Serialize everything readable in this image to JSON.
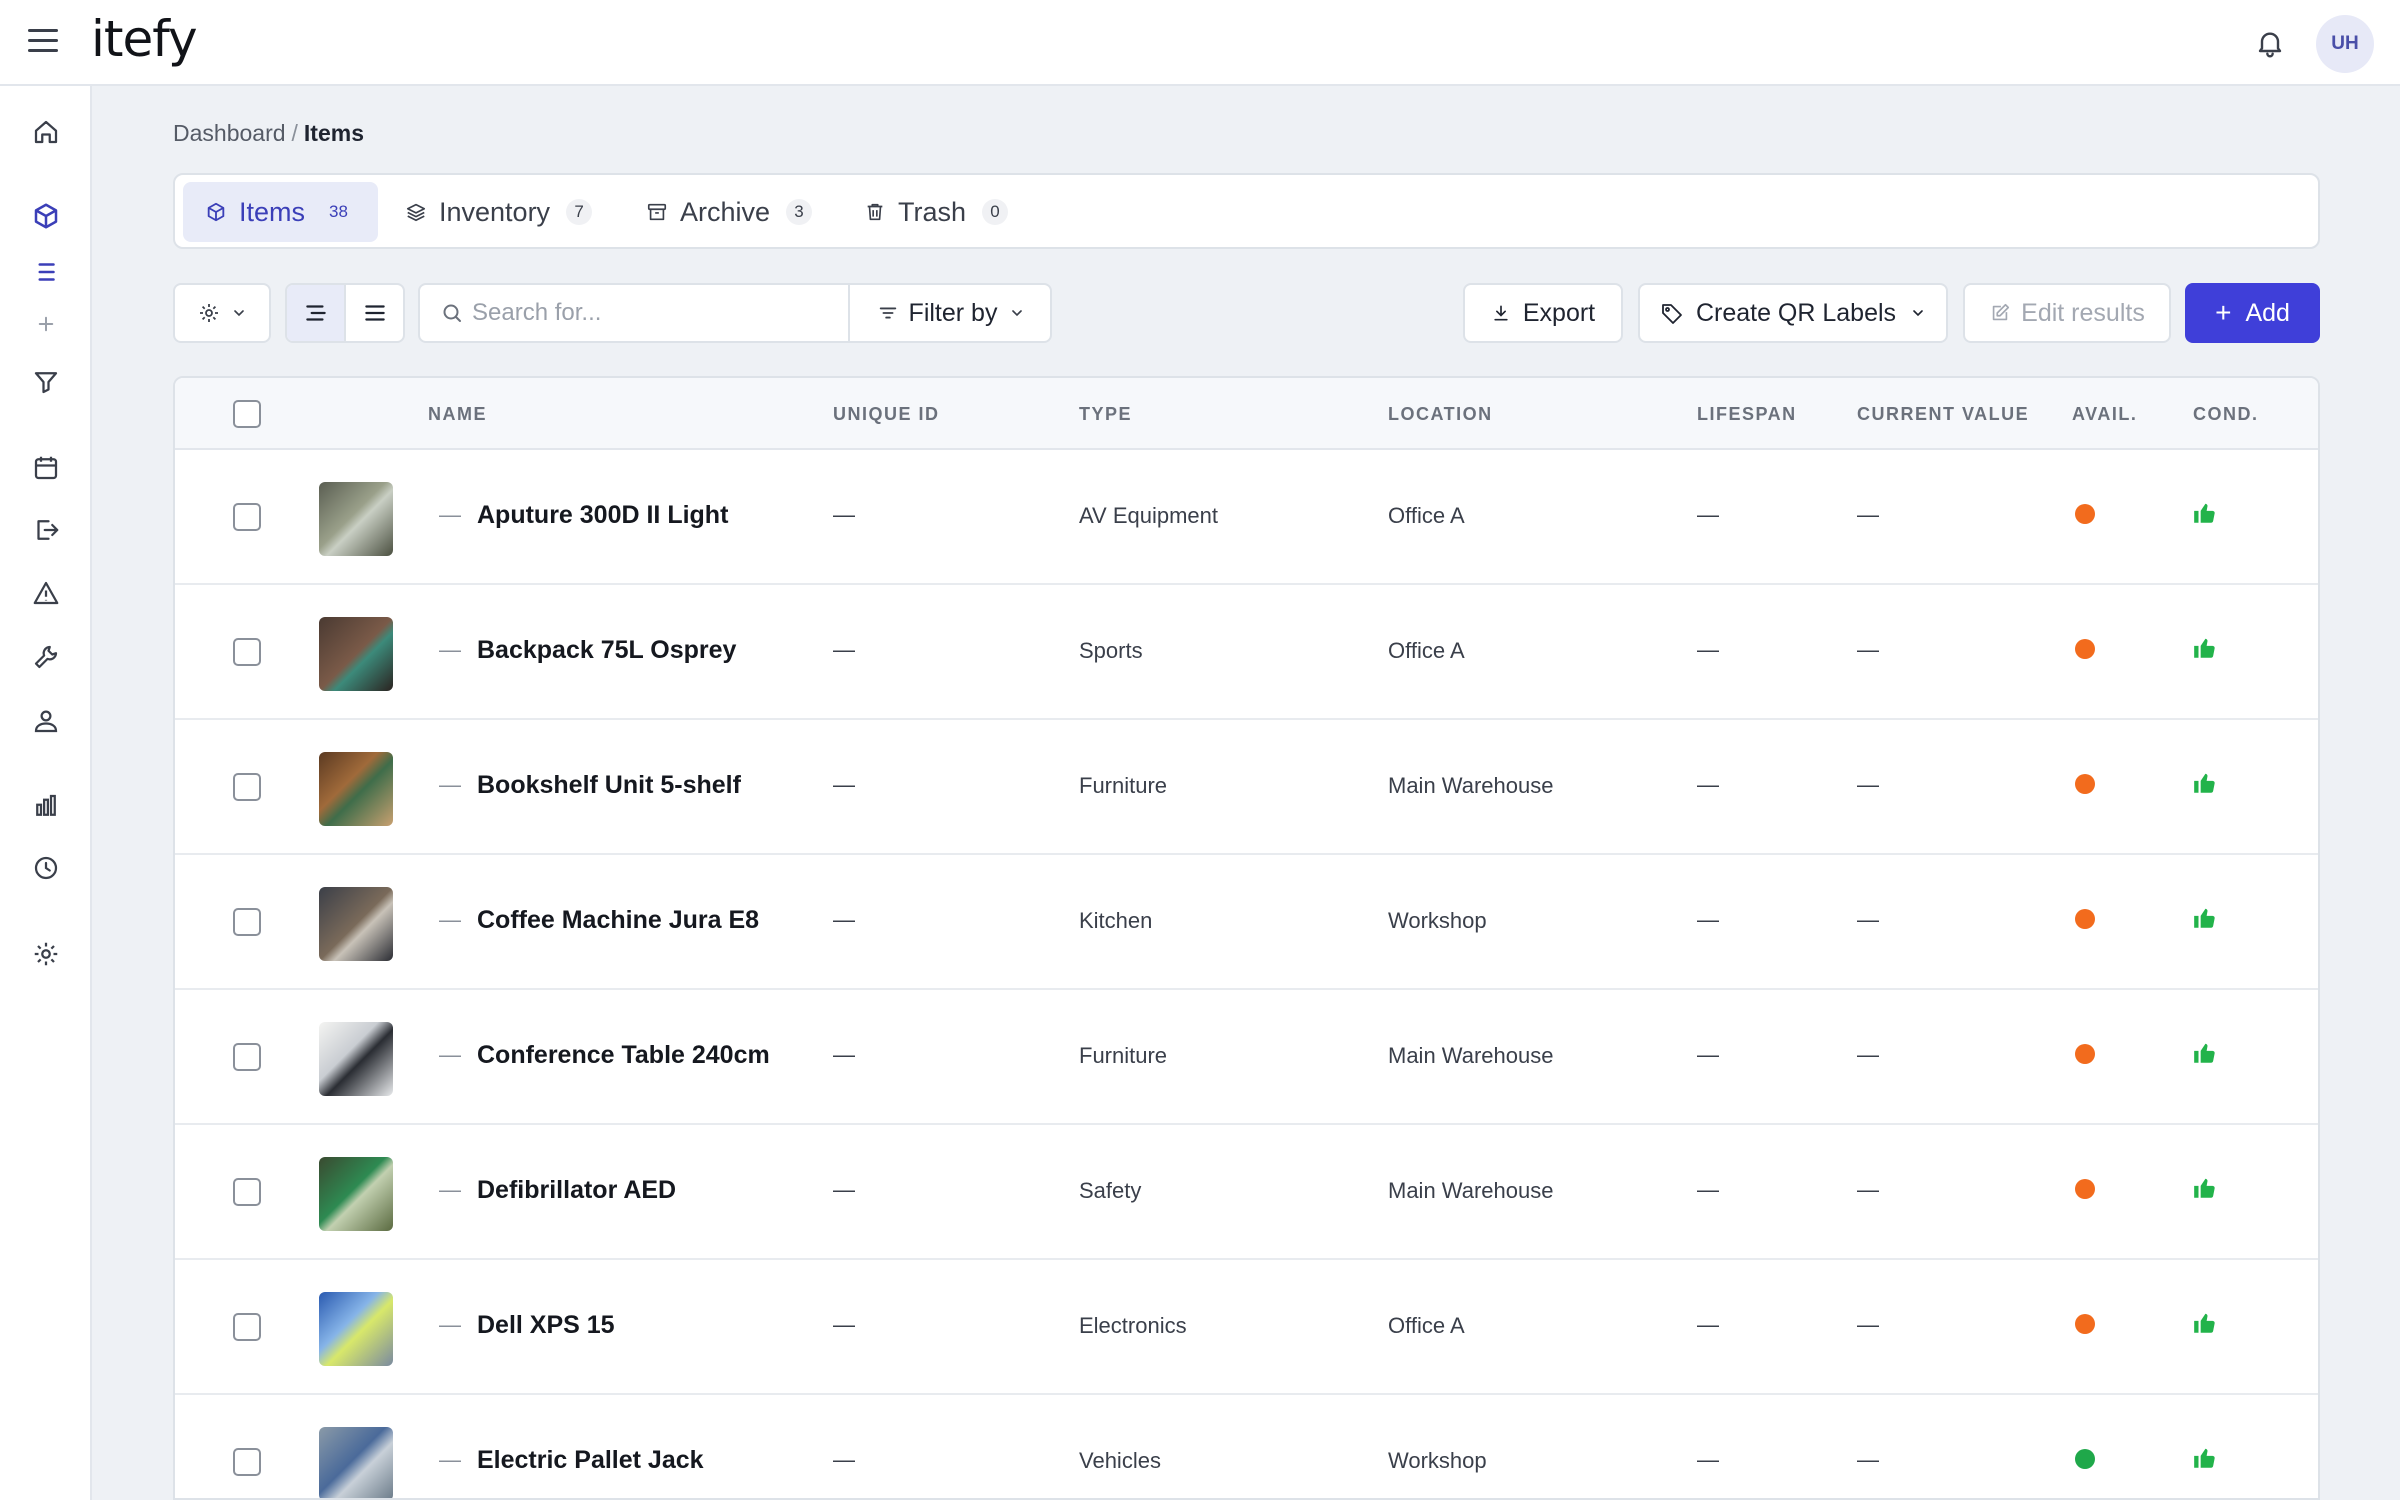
{
  "app": {
    "logo": "itefy"
  },
  "header": {
    "avatar_initials": "UH"
  },
  "breadcrumb": {
    "parent": "Dashboard",
    "separator": "/",
    "current": "Items"
  },
  "tabs": [
    {
      "label": "Items",
      "count": "38",
      "icon": "box-icon"
    },
    {
      "label": "Inventory",
      "count": "7",
      "icon": "layers-icon"
    },
    {
      "label": "Archive",
      "count": "3",
      "icon": "archive-icon"
    },
    {
      "label": "Trash",
      "count": "0",
      "icon": "trash-icon"
    }
  ],
  "toolbar": {
    "search_placeholder": "Search for...",
    "filter_label": "Filter by",
    "export_label": "Export",
    "qr_label": "Create QR Labels",
    "edit_label": "Edit results",
    "add_label": "Add"
  },
  "table": {
    "headers": {
      "name": "NAME",
      "unique_id": "UNIQUE ID",
      "type": "TYPE",
      "location": "LOCATION",
      "lifespan": "LIFESPAN",
      "current_value": "CURRENT VALUE",
      "avail": "AVAIL.",
      "cond": "COND."
    },
    "rows": [
      {
        "prefix": "—",
        "name": "Aputure 300D II Light",
        "unique_id": "—",
        "type": "AV Equipment",
        "location": "Office A",
        "lifespan": "—",
        "current_value": "—",
        "avail": "orange",
        "cond": "good"
      },
      {
        "prefix": "—",
        "name": "Backpack 75L Osprey",
        "unique_id": "—",
        "type": "Sports",
        "location": "Office A",
        "lifespan": "—",
        "current_value": "—",
        "avail": "orange",
        "cond": "good"
      },
      {
        "prefix": "—",
        "name": "Bookshelf Unit 5-shelf",
        "unique_id": "—",
        "type": "Furniture",
        "location": "Main Warehouse",
        "lifespan": "—",
        "current_value": "—",
        "avail": "orange",
        "cond": "good"
      },
      {
        "prefix": "—",
        "name": "Coffee Machine Jura E8",
        "unique_id": "—",
        "type": "Kitchen",
        "location": "Workshop",
        "lifespan": "—",
        "current_value": "—",
        "avail": "orange",
        "cond": "good"
      },
      {
        "prefix": "—",
        "name": "Conference Table 240cm",
        "unique_id": "—",
        "type": "Furniture",
        "location": "Main Warehouse",
        "lifespan": "—",
        "current_value": "—",
        "avail": "orange",
        "cond": "good"
      },
      {
        "prefix": "—",
        "name": "Defibrillator AED",
        "unique_id": "—",
        "type": "Safety",
        "location": "Main Warehouse",
        "lifespan": "—",
        "current_value": "—",
        "avail": "orange",
        "cond": "good"
      },
      {
        "prefix": "—",
        "name": "Dell XPS 15",
        "unique_id": "—",
        "type": "Electronics",
        "location": "Office A",
        "lifespan": "—",
        "current_value": "—",
        "avail": "orange",
        "cond": "good"
      },
      {
        "prefix": "—",
        "name": "Electric Pallet Jack",
        "unique_id": "—",
        "type": "Vehicles",
        "location": "Workshop",
        "lifespan": "—",
        "current_value": "—",
        "avail": "green",
        "cond": "good"
      }
    ]
  },
  "colors": {
    "accent": "#3f3fd9",
    "avail_orange": "#f26b1d",
    "avail_green": "#1fa84a",
    "cond_good": "#22b34a"
  }
}
